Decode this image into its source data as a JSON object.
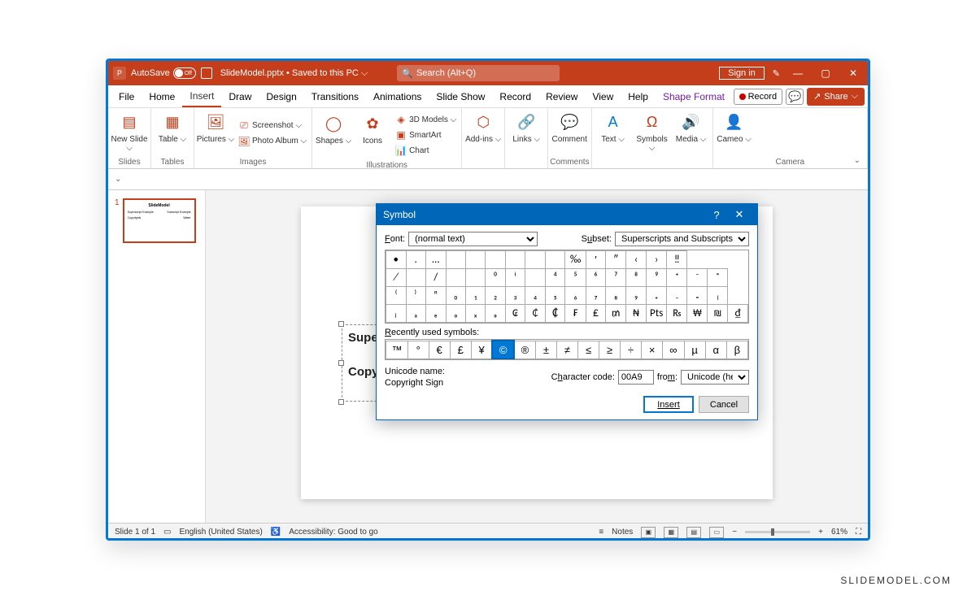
{
  "titlebar": {
    "autosave_label": "AutoSave",
    "autosave_state": "Off",
    "doc_title": "SlideModel.pptx • Saved to this PC ⌵",
    "search_placeholder": "Search (Alt+Q)",
    "signin": "Sign in"
  },
  "menubar": {
    "tabs": [
      "File",
      "Home",
      "Insert",
      "Draw",
      "Design",
      "Transitions",
      "Animations",
      "Slide Show",
      "Record",
      "Review",
      "View",
      "Help",
      "Shape Format"
    ],
    "active": "Insert",
    "record_btn": "Record",
    "share_btn": "Share"
  },
  "ribbon": {
    "new_slide": "New Slide ⌵",
    "slides_label": "Slides",
    "table": "Table ⌵",
    "tables_label": "Tables",
    "pictures": "Pictures ⌵",
    "screenshot": "Screenshot ⌵",
    "photo_album": "Photo Album ⌵",
    "images_label": "Images",
    "shapes": "Shapes ⌵",
    "icons": "Icons",
    "models3d": "3D Models ⌵",
    "smartart": "SmartArt",
    "chart": "Chart",
    "illustrations_label": "Illustrations",
    "addins": "Add-ins ⌵",
    "links": "Links ⌵",
    "comment": "Comment",
    "comments_label": "Comments",
    "text": "Text ⌵",
    "symbols": "Symbols ⌵",
    "media": "Media ⌵",
    "cameo": "Cameo ⌵",
    "camera_label": "Camera"
  },
  "thumb": {
    "num": "1",
    "title": "SlideModel",
    "l1": "Superscript Example",
    "r1": "Subscript Example",
    "l2": "Copyrights",
    "r2": "Water"
  },
  "slide": {
    "title": "SlideModel",
    "text1": "Superscript Example",
    "text2": "Copyrights:"
  },
  "dialog": {
    "title": "Symbol",
    "font_label": "Font:",
    "font_value": "(normal text)",
    "subset_label": "Subset:",
    "subset_value": "Superscripts and Subscripts",
    "grid": [
      [
        "•",
        ".",
        "…",
        "",
        "",
        "",
        "",
        "",
        "",
        "‰",
        "′",
        "″",
        "‹",
        "›",
        "‼"
      ],
      [
        "⁄",
        "",
        "/",
        "",
        "",
        "⁰",
        "ⁱ",
        "",
        "⁴",
        "⁵",
        "⁶",
        "⁷",
        "⁸",
        "⁹",
        "⁺",
        "⁻",
        "⁼"
      ],
      [
        "⁽",
        "⁾",
        "ⁿ",
        "₀",
        "₁",
        "₂",
        "₃",
        "₄",
        "₅",
        "₆",
        "₇",
        "₈",
        "₉",
        "₊",
        "₋",
        "₌",
        "₍"
      ],
      [
        "₎",
        "ₐ",
        "ₑ",
        "ₒ",
        "ₓ",
        "ₔ",
        "₢",
        "₵",
        "₡",
        "₣",
        "₤",
        "₥",
        "₦",
        "Pts",
        "₨",
        "₩",
        "₪",
        "₫"
      ]
    ],
    "recent_label": "Recently used symbols:",
    "recent": [
      "™",
      "°",
      "€",
      "£",
      "¥",
      "©",
      "®",
      "±",
      "≠",
      "≤",
      "≥",
      "÷",
      "×",
      "∞",
      "µ",
      "α",
      "β"
    ],
    "recent_selected_index": 5,
    "uname_label": "Unicode name:",
    "uname_value": "Copyright Sign",
    "charcode_label": "Character code:",
    "charcode_value": "00A9",
    "from_label": "from:",
    "from_value": "Unicode (hex)",
    "insert_btn": "Insert",
    "cancel_btn": "Cancel"
  },
  "statusbar": {
    "slide_count": "Slide 1 of 1",
    "lang": "English (United States)",
    "accessibility": "Accessibility: Good to go",
    "notes": "Notes",
    "zoom": "61%"
  },
  "watermark": "SLIDEMODEL.COM"
}
